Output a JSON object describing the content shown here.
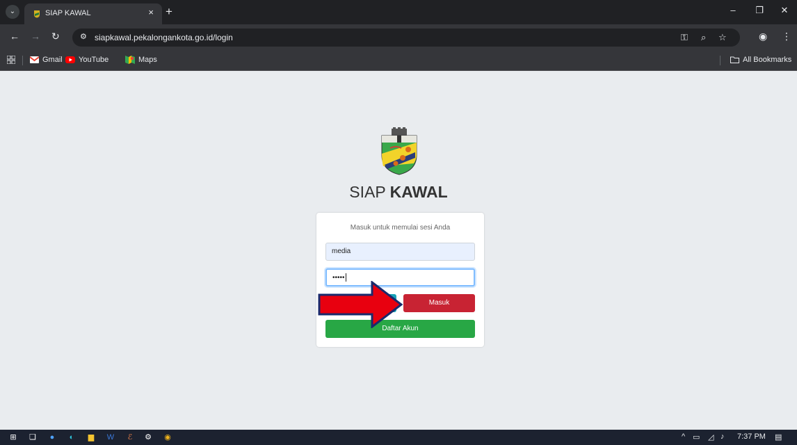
{
  "browser": {
    "tab_title": "SIAP KAWAL",
    "tab_close": "×",
    "new_tab": "+",
    "url": "siapkawal.pekalongankota.go.id/login",
    "bookmarks": [
      {
        "label": "Gmail",
        "icon": "gmail-icon"
      },
      {
        "label": "YouTube",
        "icon": "youtube-icon"
      },
      {
        "label": "Maps",
        "icon": "maps-icon"
      }
    ],
    "all_bookmarks": "All Bookmarks"
  },
  "page": {
    "brand_light": "SIAP",
    "brand_bold": "KAWAL",
    "login_message": "Masuk untuk memulai sesi Anda",
    "username_value": "media",
    "password_value": "•••••",
    "login_button": "Masuk",
    "register_button": "Daftar Akun",
    "colors": {
      "login_button": "#c82333",
      "register_button": "#28a745",
      "hidden_button": "#17a2b8",
      "annotation_arrow": "#e8000f"
    }
  },
  "taskbar": {
    "clock": "7:37 PM"
  }
}
